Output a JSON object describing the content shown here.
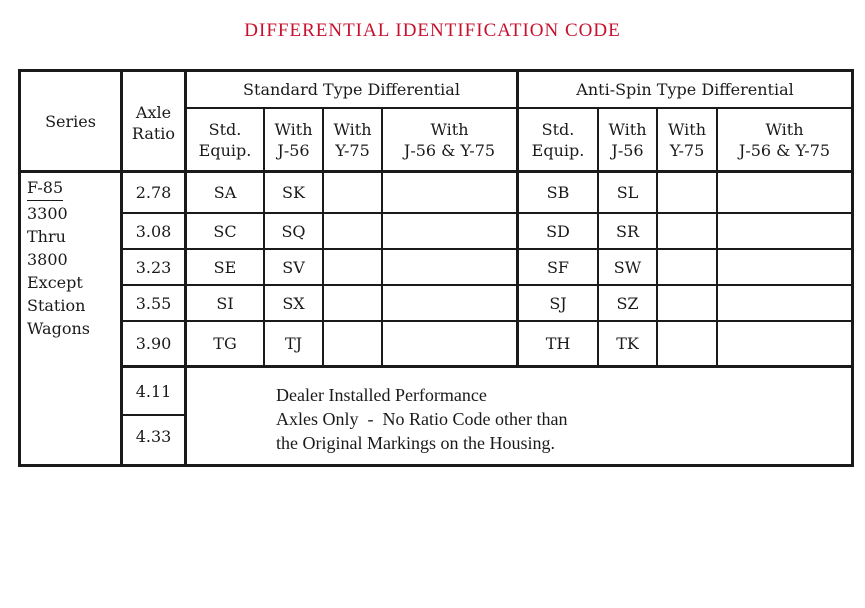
{
  "title": "DIFFERENTIAL IDENTIFICATION CODE",
  "header": {
    "series": "Series",
    "axle_ratio": [
      "Axle",
      "Ratio"
    ],
    "groups": [
      {
        "label": "Standard Type Differential",
        "columns": [
          [
            "Std.",
            "Equip."
          ],
          [
            "With",
            "J-56"
          ],
          [
            "With",
            "Y-75"
          ],
          [
            "With",
            "J-56 & Y-75"
          ]
        ]
      },
      {
        "label": "Anti-Spin Type Differential",
        "columns": [
          [
            "Std.",
            "Equip."
          ],
          [
            "With",
            "J-56"
          ],
          [
            "With",
            "Y-75"
          ],
          [
            "With",
            "J-56 & Y-75"
          ]
        ]
      }
    ]
  },
  "series_label": [
    "F-85",
    "3300",
    "Thru",
    "3800",
    "Except",
    "Station",
    "Wagons"
  ],
  "rows": [
    {
      "ratio": "2.78",
      "std": [
        "SA",
        "SK",
        "",
        ""
      ],
      "anti": [
        "SB",
        "SL",
        "",
        ""
      ]
    },
    {
      "ratio": "3.08",
      "std": [
        "SC",
        "SQ",
        "",
        ""
      ],
      "anti": [
        "SD",
        "SR",
        "",
        ""
      ]
    },
    {
      "ratio": "3.23",
      "std": [
        "SE",
        "SV",
        "",
        ""
      ],
      "anti": [
        "SF",
        "SW",
        "",
        ""
      ]
    },
    {
      "ratio": "3.55",
      "std": [
        "SI",
        "SX",
        "",
        ""
      ],
      "anti": [
        "SJ",
        "SZ",
        "",
        ""
      ]
    },
    {
      "ratio": "3.90",
      "std": [
        "TG",
        "TJ",
        "",
        ""
      ],
      "anti": [
        "TH",
        "TK",
        "",
        ""
      ]
    }
  ],
  "dealer_rows": [
    "4.11",
    "4.33"
  ],
  "dealer_note": [
    "Dealer Installed Performance",
    "Axles Only  -  No Ratio Code other than",
    "the Original Markings on the Housing."
  ]
}
